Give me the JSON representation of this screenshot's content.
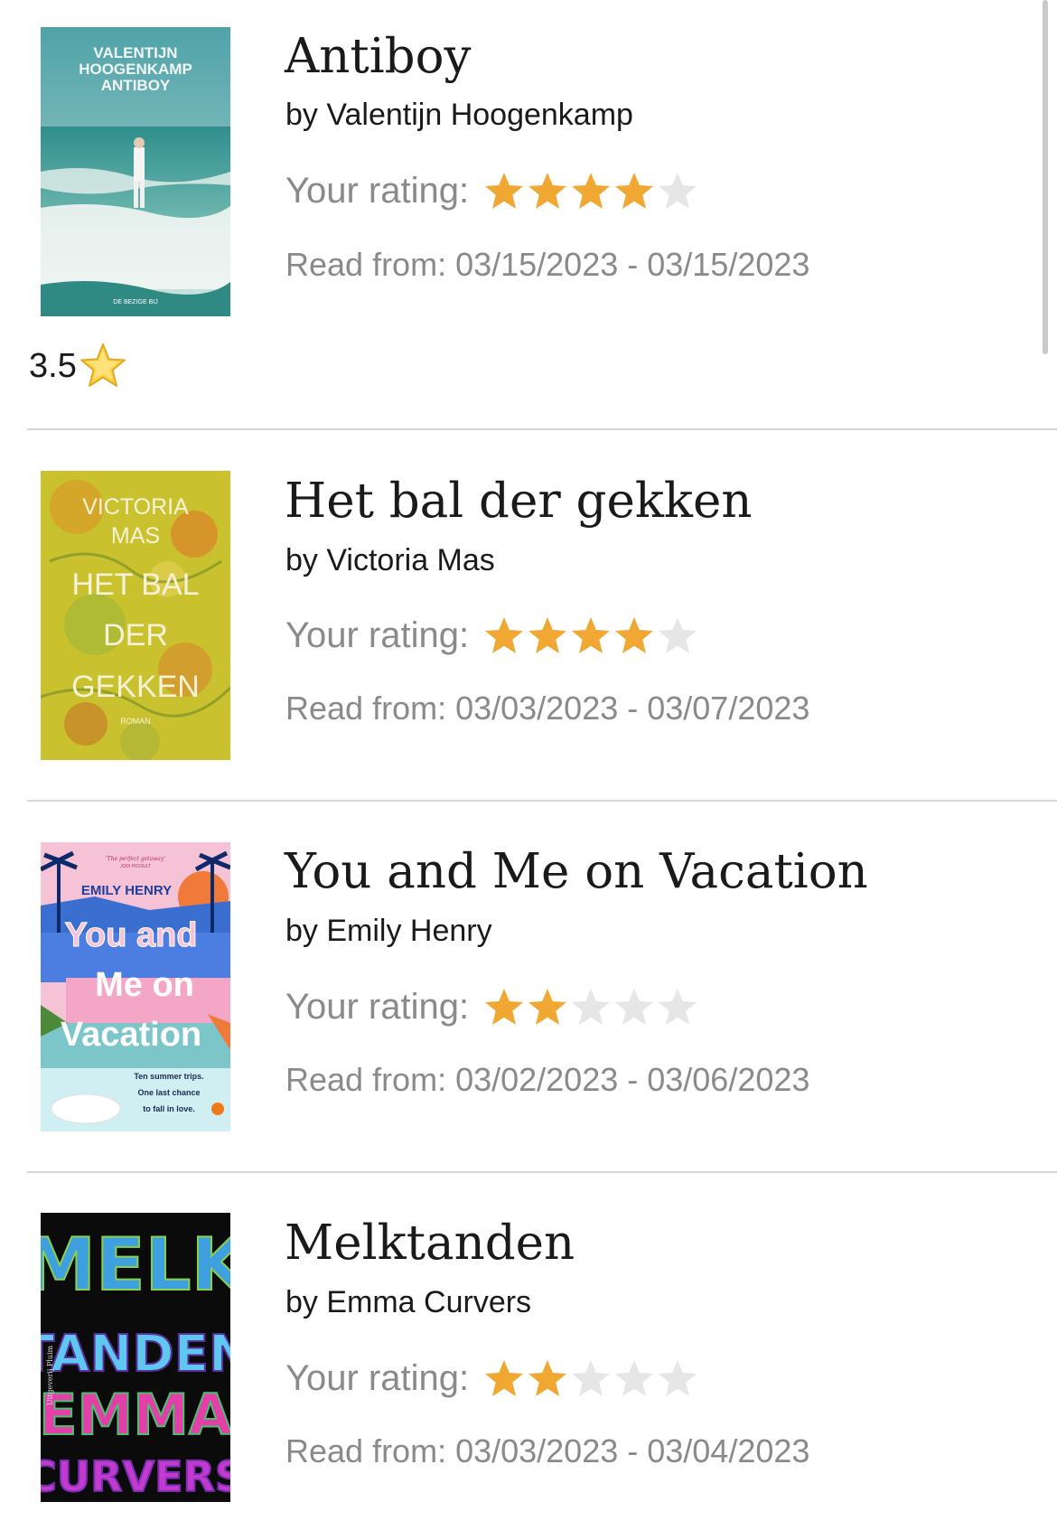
{
  "colors": {
    "star_filled": "#F0A833",
    "star_empty": "#E6E6E6",
    "muted_text": "#8A8A8A",
    "primary_text": "#1A1A1A",
    "divider": "#D6D6D6"
  },
  "rating_label": "Your rating:",
  "books": [
    {
      "title": "Antiboy",
      "author": "by Valentijn Hoogenkamp",
      "rating": 4,
      "max_rating": 5,
      "dates": "Read from: 03/15/2023 - 03/15/2023",
      "note": "3.5",
      "note_icon": "star-emoji-icon",
      "cover": {
        "lines": [
          "VALENTIJN",
          "HOOGENKAMP",
          "ANTIBOY"
        ],
        "publisher": "DE BEZIGE BIJ"
      }
    },
    {
      "title": "Het bal der gekken",
      "author": "by Victoria Mas",
      "rating": 4,
      "max_rating": 5,
      "dates": "Read from: 03/03/2023 - 03/07/2023",
      "cover": {
        "lines": [
          "VICTORIA",
          "MAS",
          "HET BAL",
          "DER",
          "GEKKEN"
        ],
        "subtitle": "ROMAN"
      }
    },
    {
      "title": "You and Me on Vacation",
      "author": "by Emily Henry",
      "rating": 2,
      "max_rating": 5,
      "dates": "Read from: 03/02/2023 - 03/06/2023",
      "cover": {
        "quote": "'The perfect getaway'",
        "quote_author": "JODI PICOULT",
        "author": "EMILY HENRY",
        "lines": [
          "You and",
          "Me on",
          "Vacation"
        ],
        "tagline": [
          "Ten summer trips.",
          "One last chance",
          "to fall in love."
        ]
      }
    },
    {
      "title": "Melktanden",
      "author": "by Emma Curvers",
      "rating": 2,
      "max_rating": 5,
      "dates": "Read from: 03/03/2023 - 03/04/2023",
      "cover": {
        "lines": [
          "MELK",
          "TANDEN",
          "EMMA",
          "CURVERS"
        ],
        "publisher": "Uitgeverij Pluim"
      }
    }
  ]
}
